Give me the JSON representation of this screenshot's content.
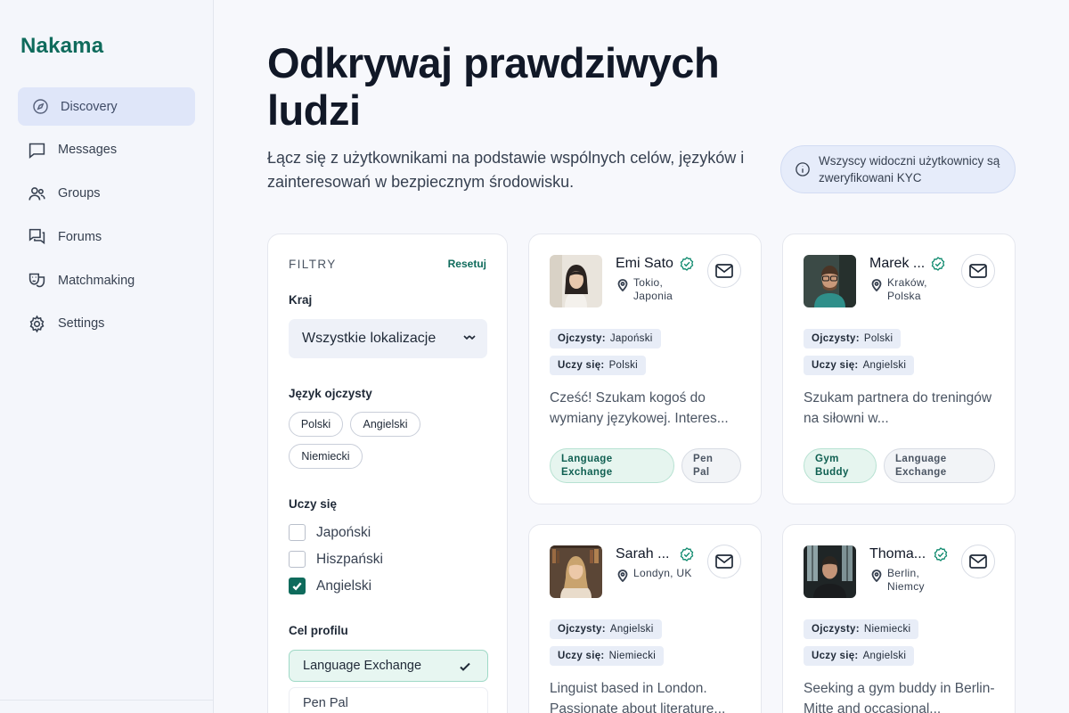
{
  "app": {
    "name": "Nakama"
  },
  "nav": [
    {
      "label": "Discovery",
      "icon": "compass-icon",
      "active": true
    },
    {
      "label": "Messages",
      "icon": "chat-icon"
    },
    {
      "label": "Groups",
      "icon": "users-icon"
    },
    {
      "label": "Forums",
      "icon": "forum-icon"
    },
    {
      "label": "Matchmaking",
      "icon": "masks-icon"
    },
    {
      "label": "Settings",
      "icon": "gear-icon"
    }
  ],
  "header": {
    "title": "Odkrywaj prawdziwych ludzi",
    "subtitle": "Łącz się z użytkownikami na podstawie wspólnych celów, języków i zainteresowań w bezpiecznym środowisku.",
    "kyc_notice": "Wszyscy widoczni użytkownicy są zweryfikowani KYC"
  },
  "filters": {
    "heading": "FILTRY",
    "reset": "Resetuj",
    "country_label": "Kraj",
    "country_value": "Wszystkie lokalizacje",
    "native_label": "Język ojczysty",
    "native_options": [
      "Polski",
      "Angielski",
      "Niemiecki"
    ],
    "learning_label": "Uczy się",
    "learning_options": [
      {
        "label": "Japoński",
        "checked": false
      },
      {
        "label": "Hiszpański",
        "checked": false
      },
      {
        "label": "Angielski",
        "checked": true
      }
    ],
    "goal_label": "Cel profilu",
    "goal_options": [
      {
        "label": "Language Exchange",
        "selected": true
      },
      {
        "label": "Pen Pal",
        "selected": false
      }
    ]
  },
  "labels": {
    "native": "Ojczysty:",
    "learning": "Uczy się:"
  },
  "profiles": [
    {
      "name": "Emi Sato",
      "location": "Tokio,\nJaponia",
      "native": "Japoński",
      "learning": "Polski",
      "bio": "Cześć! Szukam kogoś do wymiany językowej. Interes...",
      "tags": [
        {
          "label": "Language\nExchange",
          "style": "green"
        },
        {
          "label": "Pen\nPal",
          "style": "grey"
        }
      ]
    },
    {
      "name": "Marek ...",
      "location": "Kraków,\nPolska",
      "native": "Polski",
      "learning": "Angielski",
      "bio": "Szukam partnera do treningów na siłowni w...",
      "tags": [
        {
          "label": "Gym\nBuddy",
          "style": "green"
        },
        {
          "label": "Language\nExchange",
          "style": "grey"
        }
      ]
    },
    {
      "name": "Sarah ...",
      "location": "Londyn, UK",
      "native": "Angielski",
      "learning": "Niemiecki",
      "bio": "Linguist based in London. Passionate about literature...",
      "tags": []
    },
    {
      "name": "Thoma...",
      "location": "Berlin,\nNiemcy",
      "native": "Niemiecki",
      "learning": "Angielski",
      "bio": "Seeking a gym buddy in Berlin-Mitte and occasional...",
      "tags": []
    }
  ],
  "colors": {
    "brand": "#0f6b5c",
    "active_nav": "#dfe6f9",
    "verified": "#0f8a6e"
  }
}
